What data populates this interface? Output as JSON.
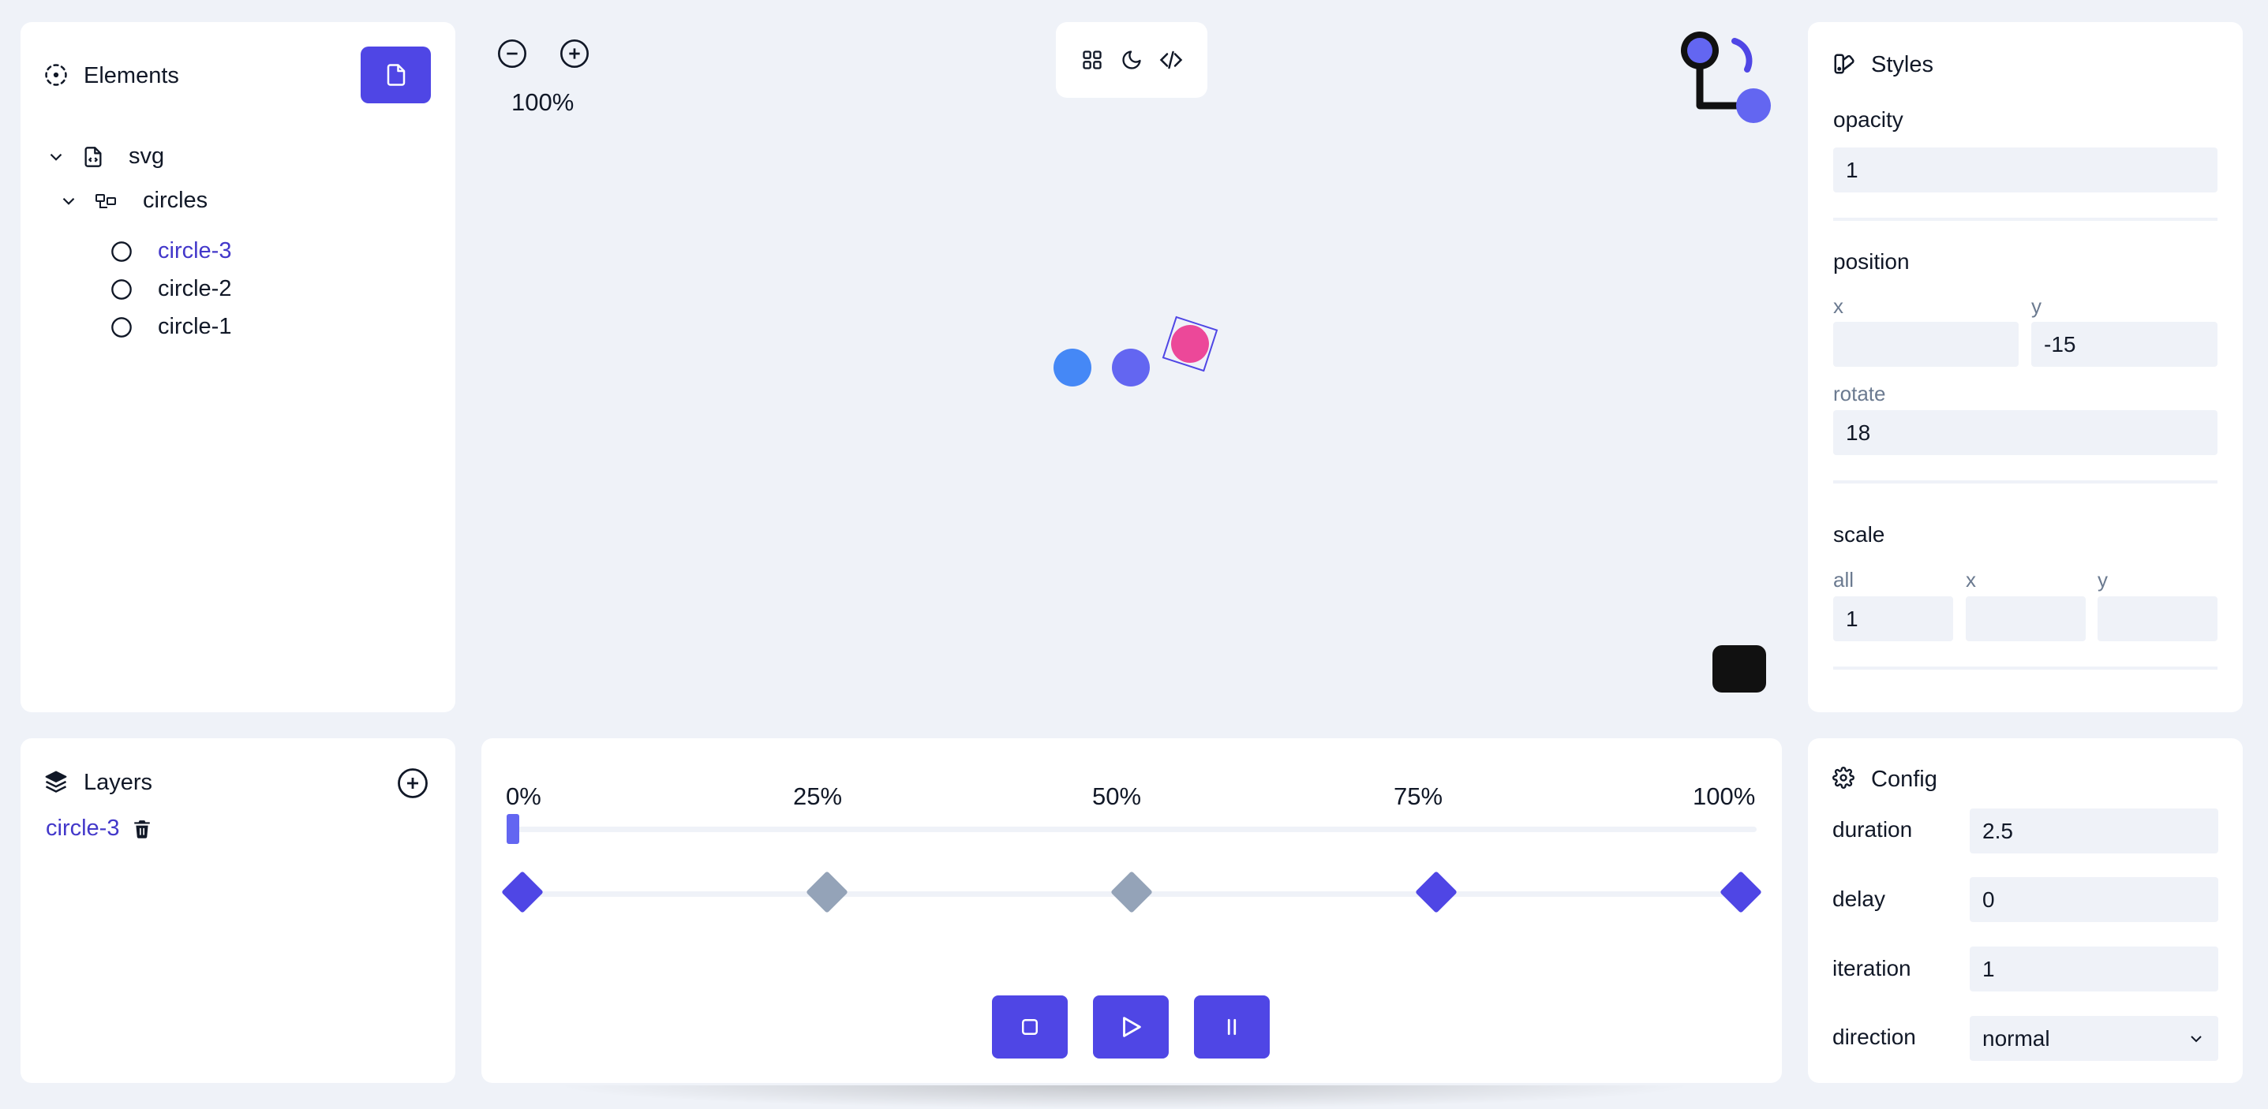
{
  "elements_panel": {
    "title": "Elements",
    "new_file_icon": "file-icon",
    "tree": {
      "root": {
        "label": "svg",
        "icon": "file-code-icon"
      },
      "group": {
        "label": "circles",
        "icon": "group-icon"
      },
      "items": [
        {
          "label": "circle-3",
          "icon": "circle-icon",
          "active": true
        },
        {
          "label": "circle-2",
          "icon": "circle-icon",
          "active": false
        },
        {
          "label": "circle-1",
          "icon": "circle-icon",
          "active": false
        }
      ]
    }
  },
  "canvas": {
    "zoom_out_icon": "minus-circle-icon",
    "zoom_in_icon": "plus-circle-icon",
    "zoom_level": "100%",
    "toolbar": [
      "grid-icon",
      "moon-icon",
      "code-icon"
    ],
    "colors": {
      "blue": "#3b82f6",
      "purple": "#6366f1",
      "pink": "#ec4899",
      "accent": "#4f46e5"
    }
  },
  "styles_panel": {
    "title": "Styles",
    "opacity": {
      "label": "opacity",
      "value": "1"
    },
    "position": {
      "label": "position",
      "x_label": "x",
      "x_value": "",
      "y_label": "y",
      "y_value": "-15",
      "rotate_label": "rotate",
      "rotate_value": "18"
    },
    "scale": {
      "label": "scale",
      "all_label": "all",
      "all_value": "1",
      "x_label": "x",
      "x_value": "",
      "y_label": "y",
      "y_value": ""
    }
  },
  "layers_panel": {
    "title": "Layers",
    "items": [
      {
        "label": "circle-3",
        "delete_icon": "trash-icon"
      }
    ]
  },
  "timeline": {
    "percent_labels": [
      "0%",
      "25%",
      "50%",
      "75%",
      "100%"
    ],
    "progress": 0,
    "keyframes": [
      {
        "position": 0,
        "state": "active"
      },
      {
        "position": 25,
        "state": "inactive"
      },
      {
        "position": 50,
        "state": "inactive"
      },
      {
        "position": 75,
        "state": "active"
      },
      {
        "position": 100,
        "state": "active"
      }
    ],
    "controls": [
      "stop-icon",
      "play-icon",
      "pause-icon"
    ]
  },
  "config_panel": {
    "title": "Config",
    "fields": {
      "duration": {
        "label": "duration",
        "value": "2.5"
      },
      "delay": {
        "label": "delay",
        "value": "0"
      },
      "iteration": {
        "label": "iteration",
        "value": "1"
      },
      "direction": {
        "label": "direction",
        "value": "normal"
      }
    }
  }
}
